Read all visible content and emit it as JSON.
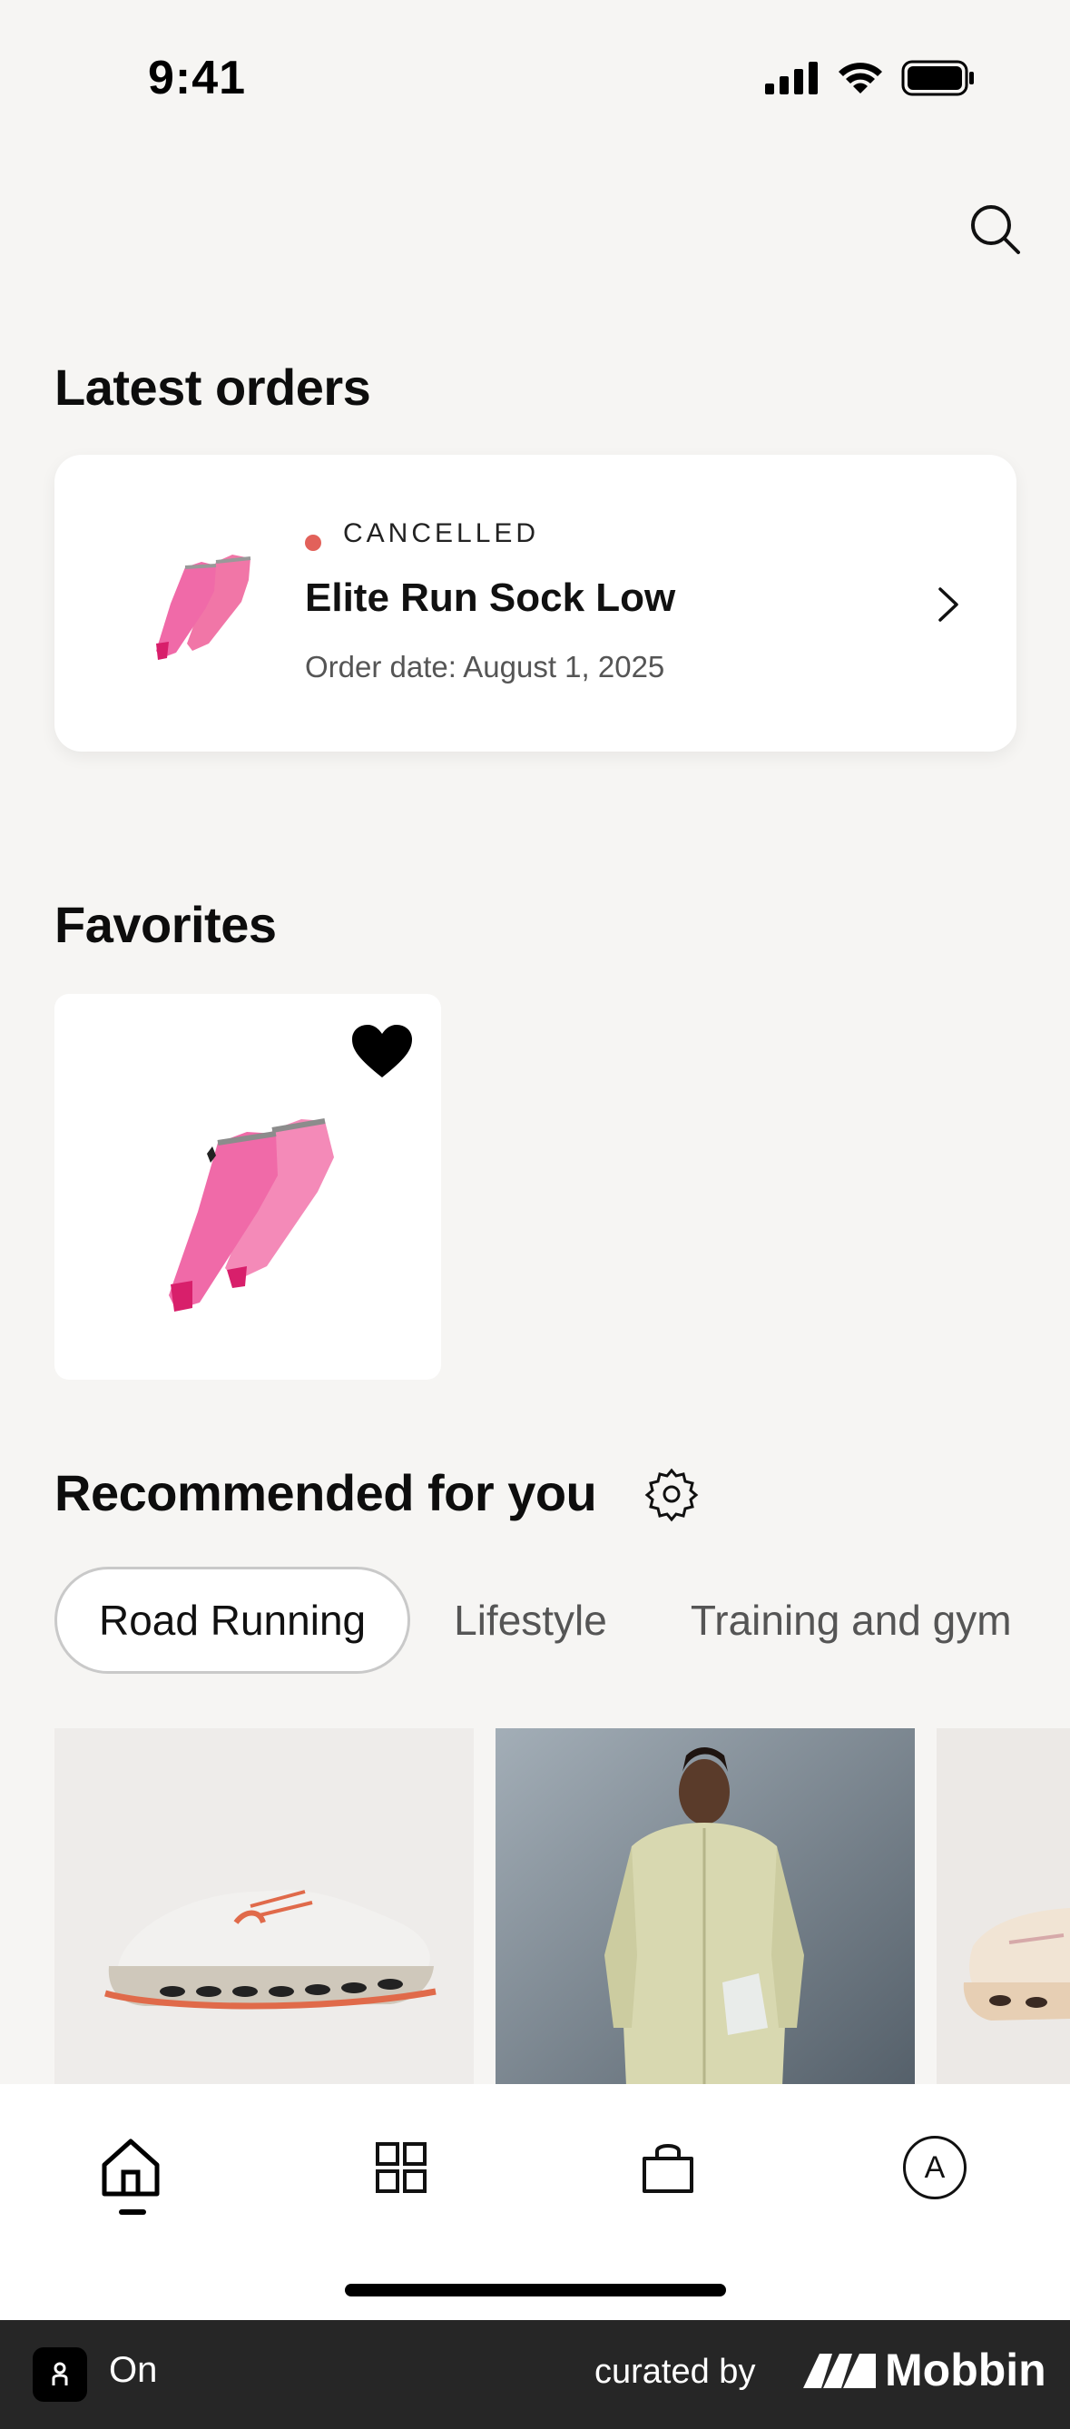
{
  "status_bar": {
    "time": "9:41"
  },
  "latest_orders": {
    "title": "Latest orders",
    "order": {
      "status": "CANCELLED",
      "status_color": "#e2615a",
      "name": "Elite Run Sock Low",
      "date": "Order date: August 1, 2025"
    }
  },
  "favorites": {
    "title": "Favorites"
  },
  "recommended": {
    "title": "Recommended for you",
    "chips": [
      "Road Running",
      "Lifestyle",
      "Training and gym"
    ],
    "active_chip": "Road Running"
  },
  "tabbar": {
    "items": [
      {
        "icon": "home-icon"
      },
      {
        "icon": "grid-icon"
      },
      {
        "icon": "bag-icon"
      },
      {
        "icon": "account-icon",
        "initial": "A"
      }
    ]
  },
  "credit": {
    "app_name": "On",
    "curated_by": "curated by",
    "brand": "Mobbin"
  },
  "colors": {
    "background": "#f6f5f3",
    "accent_pink": "#f06aa8",
    "status_red": "#e2615a"
  }
}
